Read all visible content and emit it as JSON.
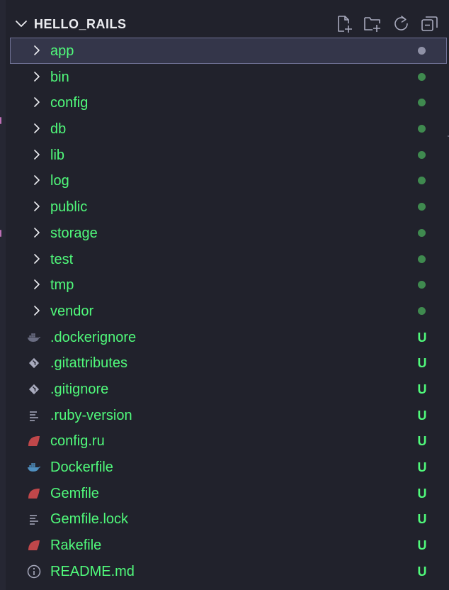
{
  "explorer": {
    "section_title": "HELLO_RAILS",
    "actions": [
      {
        "name": "new-file-button",
        "icon": "new-file-icon"
      },
      {
        "name": "new-folder-button",
        "icon": "new-folder-icon"
      },
      {
        "name": "refresh-button",
        "icon": "refresh-icon"
      },
      {
        "name": "collapse-all-button",
        "icon": "collapse-all-icon"
      }
    ]
  },
  "colors": {
    "background": "#21222c",
    "text_untracked": "#50fa7b",
    "title": "#ecedf1",
    "icon": "#a8aabd",
    "dot_added": "#3f8a4f",
    "dot_neutral": "#8f91a6",
    "ruby_red": "#c0474a",
    "docker_dim": "#6a6d82",
    "docker_blue": "#4f8fbf",
    "selection_bg": "#34364a",
    "selection_border": "#6f7194"
  },
  "tree": {
    "folders": [
      {
        "name": "app",
        "status": "dot-neutral",
        "selected": true
      },
      {
        "name": "bin",
        "status": "dot-added",
        "selected": false
      },
      {
        "name": "config",
        "status": "dot-added",
        "selected": false
      },
      {
        "name": "db",
        "status": "dot-added",
        "selected": false
      },
      {
        "name": "lib",
        "status": "dot-added",
        "selected": false
      },
      {
        "name": "log",
        "status": "dot-added",
        "selected": false
      },
      {
        "name": "public",
        "status": "dot-added",
        "selected": false
      },
      {
        "name": "storage",
        "status": "dot-added",
        "selected": false
      },
      {
        "name": "test",
        "status": "dot-added",
        "selected": false
      },
      {
        "name": "tmp",
        "status": "dot-added",
        "selected": false
      },
      {
        "name": "vendor",
        "status": "dot-added",
        "selected": false
      }
    ],
    "files": [
      {
        "name": ".dockerignore",
        "icon": "docker-icon-dim",
        "badge": "U"
      },
      {
        "name": ".gitattributes",
        "icon": "git-icon",
        "badge": "U"
      },
      {
        "name": ".gitignore",
        "icon": "git-icon",
        "badge": "U"
      },
      {
        "name": ".ruby-version",
        "icon": "text-lines-icon",
        "badge": "U"
      },
      {
        "name": "config.ru",
        "icon": "ruby-icon",
        "badge": "U"
      },
      {
        "name": "Dockerfile",
        "icon": "docker-icon",
        "badge": "U"
      },
      {
        "name": "Gemfile",
        "icon": "ruby-icon",
        "badge": "U"
      },
      {
        "name": "Gemfile.lock",
        "icon": "text-lines-icon",
        "badge": "U"
      },
      {
        "name": "Rakefile",
        "icon": "ruby-icon",
        "badge": "U"
      },
      {
        "name": "README.md",
        "icon": "info-icon",
        "badge": "U"
      }
    ]
  }
}
